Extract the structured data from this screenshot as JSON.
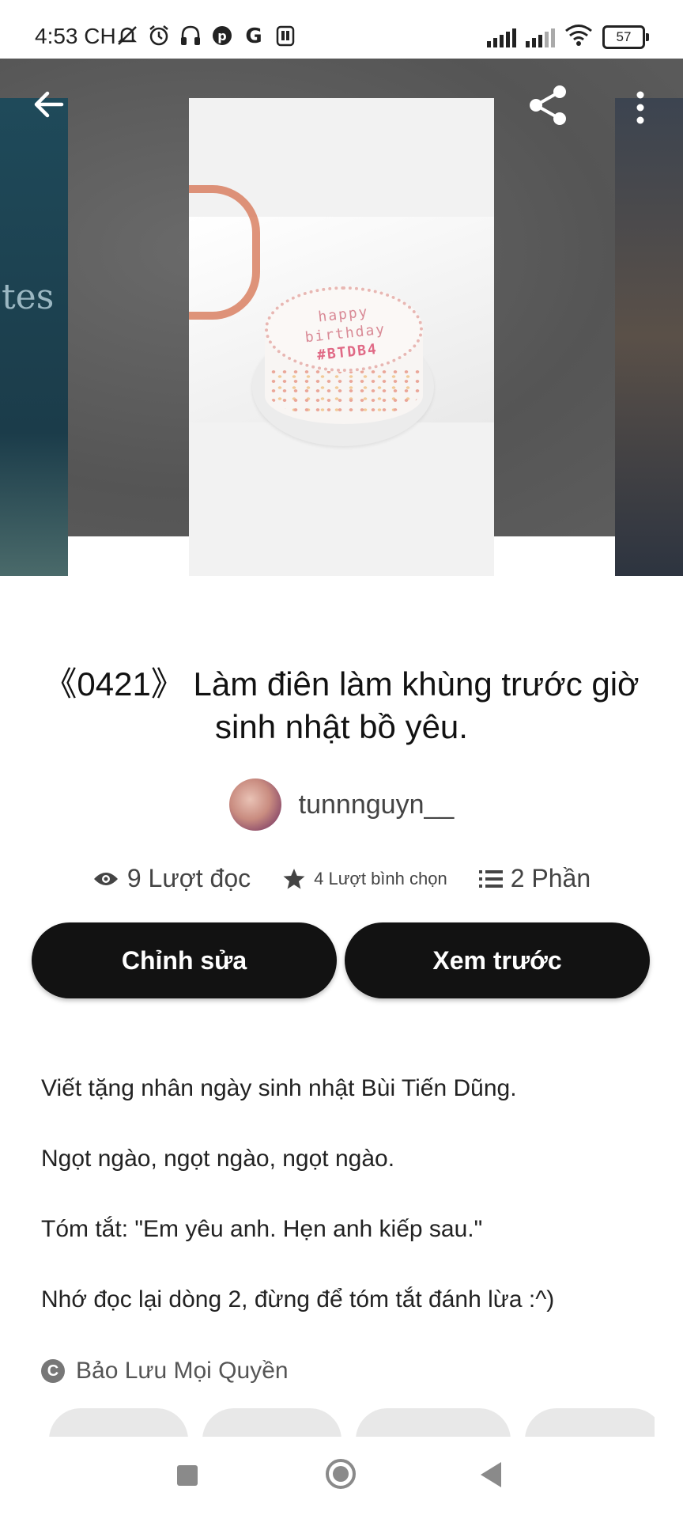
{
  "status_bar": {
    "time": "4:53 CH",
    "icons": [
      "mute-icon",
      "alarm-icon",
      "headphones-icon",
      "pinterest-icon",
      "google-icon",
      "app-icon"
    ],
    "battery": "57"
  },
  "toolbar": {
    "back_icon": "arrow-left-icon",
    "share_icon": "share-icon",
    "more_icon": "more-vertical-icon"
  },
  "cover": {
    "left_text": "tes",
    "cake_line1": "happy",
    "cake_line2": "birthday",
    "cake_tag": "#BTDB4"
  },
  "story": {
    "title": "《0421》 Làm điên làm khùng trước giờ sinh nhật bồ yêu.",
    "author": "tunnnguyn__",
    "reads": "9 Lượt đọc",
    "votes": "4 Lượt bình chọn",
    "parts": "2 Phần"
  },
  "actions": {
    "edit_label": "Chỉnh sửa",
    "preview_label": "Xem trước"
  },
  "description": {
    "line1": "Viết tặng nhân ngày sinh nhật Bùi Tiến Dũng.",
    "line2": "Ngọt ngào, ngọt ngào, ngọt ngào.",
    "line3": "Tóm tắt: \"Em yêu anh. Hẹn anh kiếp sau.\"",
    "line4": "Nhớ đọc lại dòng 2, đừng để tóm tắt đánh lừa :^)"
  },
  "copyright": {
    "icon": "C",
    "label": "Bảo Lưu Mọi Quyền"
  },
  "navbar": {
    "icons": [
      "recents-icon",
      "home-icon",
      "back-icon"
    ]
  }
}
